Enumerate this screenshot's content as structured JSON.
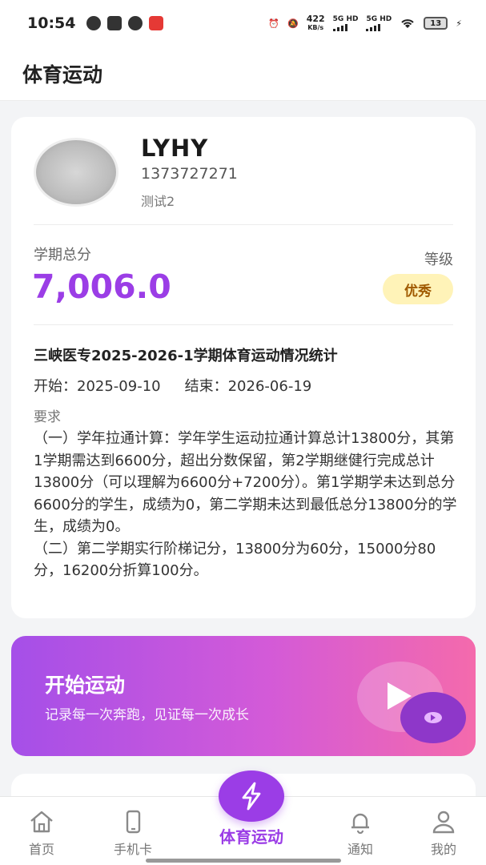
{
  "status_bar": {
    "time": "10:54",
    "net_speed_value": "422",
    "net_speed_unit": "KB/s",
    "sim1": "5G HD",
    "sim2": "5G HD",
    "battery": "13"
  },
  "header": {
    "title": "体育运动"
  },
  "profile": {
    "name": "LYHY",
    "phone": "1373727271",
    "tag": "测试2"
  },
  "score": {
    "label": "学期总分",
    "value": "7,006.0",
    "level_label": "等级",
    "level": "优秀"
  },
  "stats": {
    "title": "三峡医专2025-2026-1学期体育运动情况统计",
    "start_label": "开始：",
    "start_date": "2025-09-10",
    "end_label": "结束：",
    "end_date": "2026-06-19",
    "requirement_label": "要求",
    "requirement_text": "（一）学年拉通计算：学年学生运动拉通计算总计13800分，其第1学期需达到6600分，超出分数保留，第2学期继健行完成总计13800分（可以理解为6600分+7200分）。第1学期学未达到总分6600分的学生，成绩为0，第二学期未达到最低总分13800分的学生，成绩为0。\n（二）第二学期实行阶梯记分，13800分为60分，15000分80分，16200分折算100分。"
  },
  "start_banner": {
    "title": "开始运动",
    "subtitle": "记录每一次奔跑，见证每一次成长"
  },
  "nav": {
    "home": "首页",
    "phone_card": "手机卡",
    "sports": "体育运动",
    "notice": "通知",
    "mine": "我的"
  },
  "colors": {
    "accent": "#9b3de6",
    "badge_bg": "#fff3b8",
    "badge_text": "#a05a00"
  }
}
